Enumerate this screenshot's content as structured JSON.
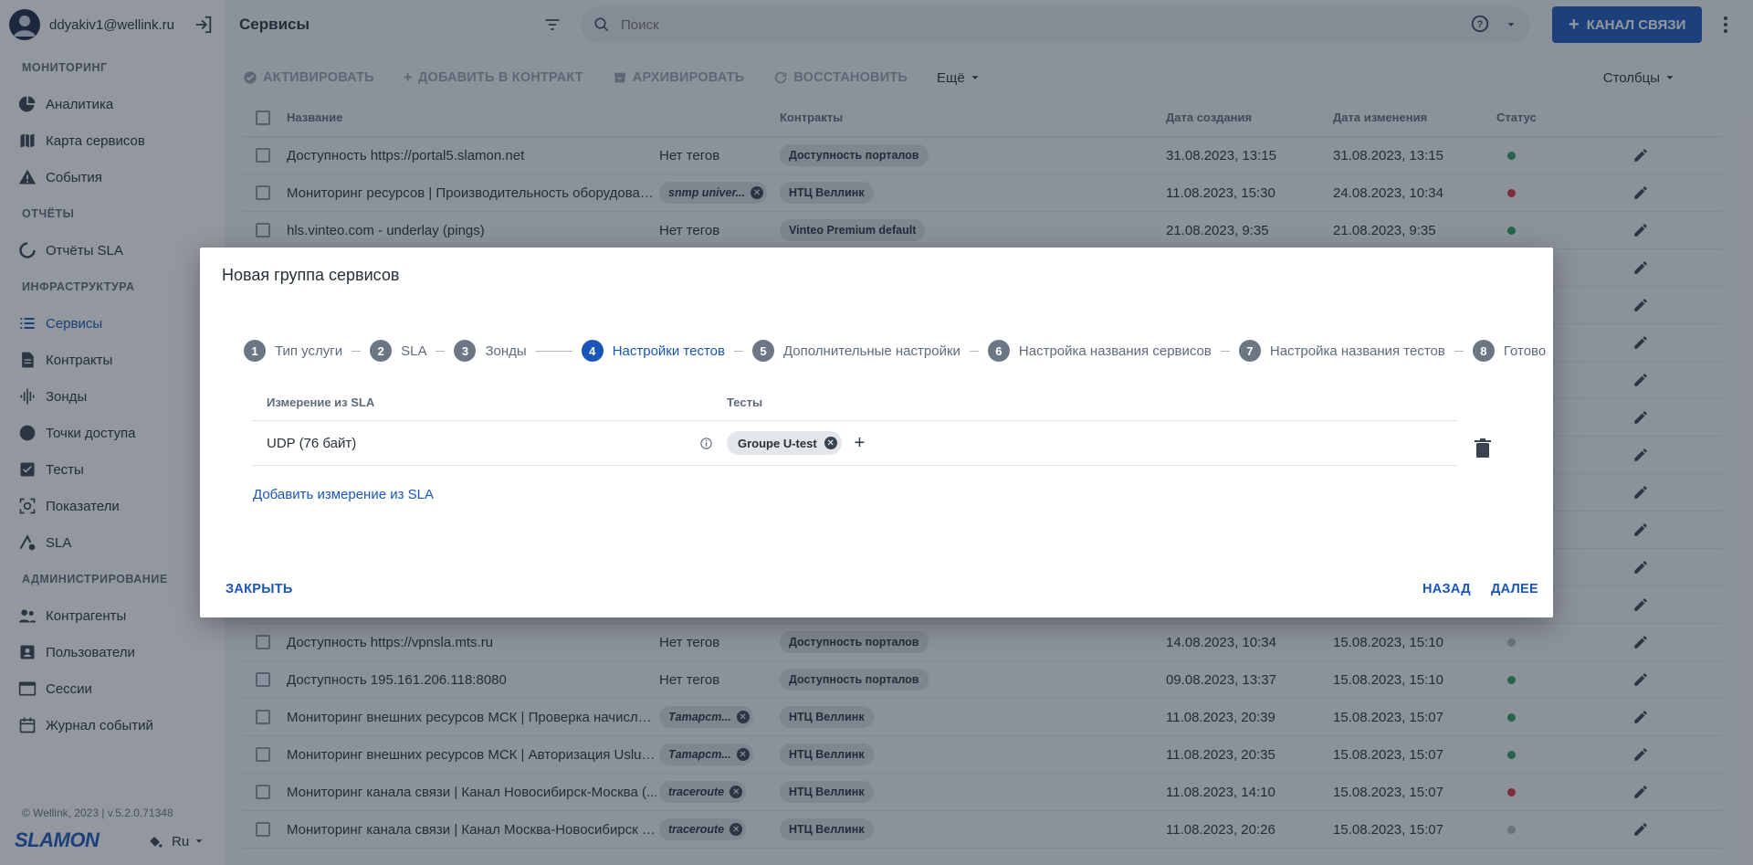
{
  "user": {
    "email": "ddyakiv1@wellink.ru"
  },
  "sidebar": {
    "sections": [
      {
        "title": "МОНИТОРИНГ",
        "items": [
          {
            "label": "Аналитика",
            "icon": "pie-chart-icon"
          },
          {
            "label": "Карта сервисов",
            "icon": "map-icon"
          },
          {
            "label": "События",
            "icon": "warning-icon"
          }
        ]
      },
      {
        "title": "ОТЧЁТЫ",
        "items": [
          {
            "label": "Отчёты SLA",
            "icon": "report-icon"
          }
        ]
      },
      {
        "title": "ИНФРАСТРУКТУРА",
        "items": [
          {
            "label": "Сервисы",
            "icon": "list-icon",
            "active": true
          },
          {
            "label": "Контракты",
            "icon": "document-icon"
          },
          {
            "label": "Зонды",
            "icon": "probe-icon"
          },
          {
            "label": "Точки доступа",
            "icon": "circle-icon"
          },
          {
            "label": "Тесты",
            "icon": "checklist-icon"
          },
          {
            "label": "Показатели",
            "icon": "metrics-icon"
          },
          {
            "label": "SLA",
            "icon": "sla-icon"
          }
        ]
      },
      {
        "title": "АДМИНИСТРИРОВАНИЕ",
        "items": [
          {
            "label": "Контрагенты",
            "icon": "people-icon"
          },
          {
            "label": "Пользователи",
            "icon": "user-card-icon"
          },
          {
            "label": "Сессии",
            "icon": "window-icon"
          },
          {
            "label": "Журнал событий",
            "icon": "calendar-icon"
          }
        ]
      }
    ],
    "copyright": "© Wellink, 2023 | v.5.2.0.71348",
    "logo": "SLAMON",
    "lang": "Ru"
  },
  "header": {
    "title": "Сервисы",
    "search_placeholder": "Поиск",
    "primary_button": "КАНАЛ СВЯЗИ"
  },
  "toolbar": {
    "activate": "АКТИВИРОВАТЬ",
    "add_to_contract": "ДОБАВИТЬ В КОНТРАКТ",
    "archive": "АРХИВИРОВАТЬ",
    "restore": "ВОССТАНОВИТЬ",
    "more": "Ещё",
    "columns": "Столбцы"
  },
  "table": {
    "headers": {
      "name": "Название",
      "contracts": "Контракты",
      "created": "Дата создания",
      "modified": "Дата изменения",
      "status": "Статус"
    },
    "rows": [
      {
        "name": "Доступность https://portal5.slamon.net",
        "tag": "Нет тегов",
        "has_tag_chip": false,
        "contract": "Доступность порталов",
        "created": "31.08.2023, 13:15",
        "modified": "31.08.2023, 13:15",
        "status_color": "#2e9e5b"
      },
      {
        "name": "Мониторинг ресурсов | Производительность оборудования",
        "tag": "snmp univer...",
        "has_tag_chip": true,
        "contract": "НТЦ Веллинк",
        "created": "11.08.2023, 15:30",
        "modified": "24.08.2023, 10:34",
        "status_color": "#d9363e"
      },
      {
        "name": "hls.vinteo.com - underlay (pings)",
        "tag": "Нет тегов",
        "has_tag_chip": false,
        "contract": "Vinteo Premium default",
        "created": "21.08.2023, 9:35",
        "modified": "21.08.2023, 9:35",
        "status_color": "#2e9e5b"
      },
      {
        "name": "",
        "tag": "",
        "has_tag_chip": false,
        "contract": "",
        "created": "",
        "modified": "",
        "status_color": ""
      },
      {
        "name": "",
        "tag": "",
        "has_tag_chip": false,
        "contract": "",
        "created": "",
        "modified": "",
        "status_color": ""
      },
      {
        "name": "",
        "tag": "",
        "has_tag_chip": false,
        "contract": "",
        "created": "",
        "modified": "",
        "status_color": ""
      },
      {
        "name": "",
        "tag": "",
        "has_tag_chip": false,
        "contract": "",
        "created": "",
        "modified": "",
        "status_color": ""
      },
      {
        "name": "",
        "tag": "",
        "has_tag_chip": false,
        "contract": "",
        "created": "",
        "modified": "",
        "status_color": ""
      },
      {
        "name": "",
        "tag": "",
        "has_tag_chip": false,
        "contract": "",
        "created": "",
        "modified": "",
        "status_color": ""
      },
      {
        "name": "",
        "tag": "",
        "has_tag_chip": false,
        "contract": "",
        "created": "",
        "modified": "",
        "status_color": ""
      },
      {
        "name": "",
        "tag": "",
        "has_tag_chip": false,
        "contract": "",
        "created": "",
        "modified": "",
        "status_color": ""
      },
      {
        "name": "",
        "tag": "",
        "has_tag_chip": false,
        "contract": "",
        "created": "",
        "modified": "",
        "status_color": ""
      },
      {
        "name": "",
        "tag": "",
        "has_tag_chip": false,
        "contract": "",
        "created": "",
        "modified": "",
        "status_color": ""
      },
      {
        "name": "Доступность https://vpnsla.mts.ru",
        "tag": "Нет тегов",
        "has_tag_chip": false,
        "contract": "Доступность порталов",
        "created": "14.08.2023, 10:34",
        "modified": "15.08.2023, 15:10",
        "status_color": "#b0b7bf"
      },
      {
        "name": "Доступность 195.161.206.118:8080",
        "tag": "Нет тегов",
        "has_tag_chip": false,
        "contract": "Доступность порталов",
        "created": "09.08.2023, 13:37",
        "modified": "15.08.2023, 15:10",
        "status_color": "#2e9e5b"
      },
      {
        "name": "Мониторинг внешних ресурсов МСК | Проверка начисления",
        "tag": "Татарст...",
        "has_tag_chip": true,
        "contract": "НТЦ Веллинк",
        "created": "11.08.2023, 20:39",
        "modified": "15.08.2023, 15:07",
        "status_color": "#2e9e5b"
      },
      {
        "name": "Мониторинг внешних ресурсов МСК | Авторизация Uslugi.tatar",
        "tag": "Татарст...",
        "has_tag_chip": true,
        "contract": "НТЦ Веллинк",
        "created": "11.08.2023, 20:35",
        "modified": "15.08.2023, 15:07",
        "status_color": "#2e9e5b"
      },
      {
        "name": "Мониторинг канала связи | Канал Новосибирск-Москва (...",
        "tag": "traceroute",
        "has_tag_chip": true,
        "contract": "НТЦ Веллинк",
        "created": "11.08.2023, 14:10",
        "modified": "15.08.2023, 15:07",
        "status_color": "#d9363e"
      },
      {
        "name": "Мониторинг канала связи | Канал Москва-Новосибирск (С...",
        "tag": "traceroute",
        "has_tag_chip": true,
        "contract": "НТЦ Веллинк",
        "created": "11.08.2023, 20:26",
        "modified": "15.08.2023, 15:07",
        "status_color": "#b0b7bf"
      }
    ]
  },
  "modal": {
    "title": "Новая группа сервисов",
    "steps": [
      {
        "num": "1",
        "label": "Тип услуги"
      },
      {
        "num": "2",
        "label": "SLA"
      },
      {
        "num": "3",
        "label": "Зонды"
      },
      {
        "num": "4",
        "label": "Настройки тестов",
        "active": true
      },
      {
        "num": "5",
        "label": "Дополнительные настройки"
      },
      {
        "num": "6",
        "label": "Настройка названия сервисов"
      },
      {
        "num": "7",
        "label": "Настройка названия тестов"
      },
      {
        "num": "8",
        "label": "Готово"
      }
    ],
    "col_measure": "Измерение из SLA",
    "col_tests": "Тесты",
    "row_measure": "UDP (76 байт)",
    "row_test_chip": "Groupe U-test",
    "add_link": "Добавить измерение из SLA",
    "close": "ЗАКРЫТЬ",
    "back": "НАЗАД",
    "next": "ДАЛЕЕ"
  },
  "colors": {
    "accent": "#1a56b8",
    "overlay": "rgba(30,40,55,0.48)"
  }
}
